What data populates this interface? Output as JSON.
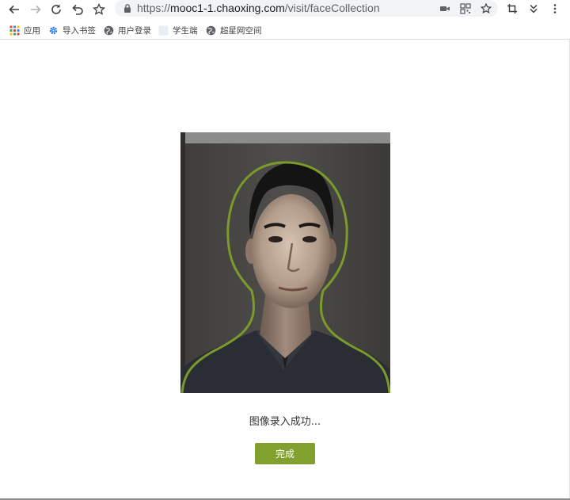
{
  "browser": {
    "url_host": "mooc1-1.chaoxing.com",
    "url_prefix": "https://",
    "url_path": "/visit/faceCollection",
    "icons": {
      "back": "back-arrow-icon",
      "forward": "forward-arrow-icon",
      "reload": "reload-icon",
      "undo": "undo-icon",
      "star": "star-icon",
      "lock": "lock-icon",
      "camera": "camera-icon",
      "qr": "qr-code-icon",
      "crop": "crop-icon",
      "menu": "more-menu-icon"
    }
  },
  "bookmarks": [
    {
      "label": "应用",
      "icon": "apps-grid-icon"
    },
    {
      "label": "导入书签",
      "icon": "gear-icon"
    },
    {
      "label": "用户登录",
      "icon": "globe-icon"
    },
    {
      "label": "学生端",
      "icon": "blank-page-icon"
    },
    {
      "label": "超星网空间",
      "icon": "globe-icon"
    }
  ],
  "page": {
    "status_text": "图像录入成功...",
    "done_label": "完成",
    "accent_color": "#82a02e"
  }
}
